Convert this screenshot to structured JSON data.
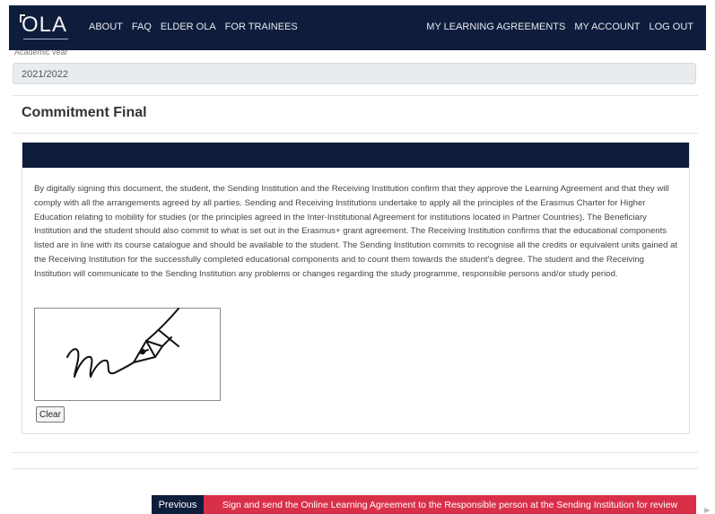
{
  "header": {
    "logo_text": "OLA",
    "nav_left": [
      "ABOUT",
      "FAQ",
      "ELDER OLA",
      "FOR TRAINEES"
    ],
    "nav_right": [
      "MY LEARNING AGREEMENTS",
      "MY ACCOUNT",
      "LOG OUT"
    ]
  },
  "academic_year": {
    "label": "Academic year",
    "value": "2021/2022"
  },
  "commitment": {
    "title": "Commitment Final",
    "text": "By digitally signing this document, the student, the Sending Institution and the Receiving Institution confirm that they approve the Learning Agreement and that they will comply with all the arrangements agreed by all parties. Sending and Receiving Institutions undertake to apply all the principles of the Erasmus Charter for Higher Education relating to mobility for studies (or the principles agreed in the Inter-Institutional Agreement for institutions located in Partner Countries). The Beneficiary Institution and the student should also commit to what is set out in the Erasmus+ grant agreement. The Receiving Institution confirms that the educational components listed are in line with its course catalogue and should be available to the student. The Sending Institution commits to recognise all the credits or equivalent units gained at the Receiving Institution for the successfully completed educational components and to count them towards the student's degree. The student and the Receiving Institution will communicate to the Sending Institution any problems or changes regarding the study programme, responsible persons and/or study period.",
    "clear_label": "Clear"
  },
  "actions": {
    "previous_label": "Previous",
    "sign_label": "Sign and send the Online Learning Agreement to the Responsible person at the Sending Institution for review"
  },
  "colors": {
    "navy": "#0f1d3c",
    "accent_red": "#d9304a"
  }
}
